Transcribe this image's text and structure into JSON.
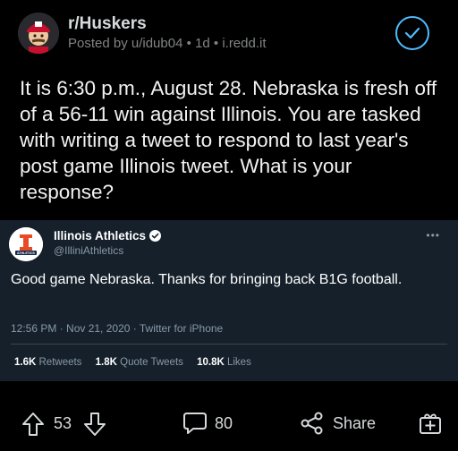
{
  "post": {
    "subreddit": "r/Huskers",
    "posted_by": "Posted by u/idub04",
    "age": "1d",
    "domain": "i.redd.it",
    "title": "It is 6:30 p.m., August 28. Nebraska is fresh off of a 56-11 win against Illinois. You are tasked with writing a tweet to respond to last year's post game Illinois tweet. What is your response?"
  },
  "tweet": {
    "account_name": "Illinois Athletics",
    "handle": "@IlliniAthletics",
    "text": "Good game Nebraska. Thanks for bringing back B1G football.",
    "timestamp": "12:56 PM · Nov 21, 2020 · Twitter for iPhone",
    "retweets_count": "1.6K",
    "retweets_label": "Retweets",
    "quotes_count": "1.8K",
    "quotes_label": "Quote Tweets",
    "likes_count": "10.8K",
    "likes_label": "Likes",
    "more": "•••"
  },
  "actions": {
    "upvotes": "53",
    "comments": "80",
    "share_label": "Share"
  },
  "colors": {
    "background": "#000000",
    "tweet_background": "#15202b",
    "accent": "#4fbcff",
    "illinois_orange": "#e84a27",
    "illinois_blue": "#13294b"
  }
}
